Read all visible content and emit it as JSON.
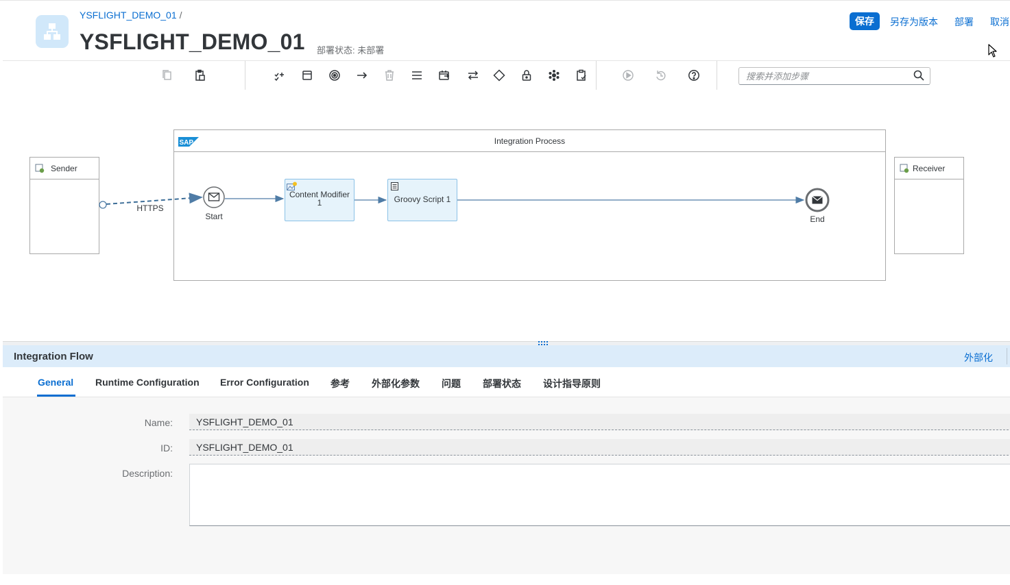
{
  "header": {
    "breadcrumb": "YSFLIGHT_DEMO_01",
    "breadcrumb_sep": "/",
    "title": "YSFLIGHT_DEMO_01",
    "deploy_status": "部署状态: 未部署",
    "actions": {
      "save": "保存",
      "save_as_version": "另存为版本",
      "deploy": "部署",
      "cancel": "取消"
    }
  },
  "toolbar": {
    "search_placeholder": "搜索并添加步骤",
    "icons": [
      "copy-icon",
      "paste-icon",
      "participants-icon",
      "process-icon",
      "events-icon",
      "connector-icon",
      "delete-icon",
      "message-transformers-icon",
      "call-icon",
      "routing-icon",
      "gateway-icon",
      "security-icon",
      "persistence-icon",
      "validator-icon",
      "simulation-icon",
      "undo-icon",
      "help-icon",
      "search-icon"
    ]
  },
  "diagram": {
    "sender": "Sender",
    "receiver": "Receiver",
    "process_title": "Integration Process",
    "sap_logo": "SAP",
    "adapter_label": "HTTPS",
    "start_label": "Start",
    "end_label": "End",
    "steps": [
      {
        "line1": "Content Modifier",
        "line2": "1"
      },
      {
        "line1": "Groovy Script 1"
      }
    ]
  },
  "panel": {
    "title": "Integration Flow",
    "externalize": "外部化",
    "tabs": [
      "General",
      "Runtime Configuration",
      "Error Configuration",
      "参考",
      "外部化参数",
      "问题",
      "部署状态",
      "设计指导原则"
    ],
    "active_tab": "General",
    "fields": {
      "name_label": "Name:",
      "name_value": "YSFLIGHT_DEMO_01",
      "id_label": "ID:",
      "id_value": "YSFLIGHT_DEMO_01",
      "description_label": "Description:",
      "description_value": ""
    }
  },
  "colors": {
    "accent": "#0a6ed1",
    "panel_header_bg": "#dcecfa",
    "step_fill": "#e6f3fb",
    "flow_line": "#4f7ca6"
  }
}
